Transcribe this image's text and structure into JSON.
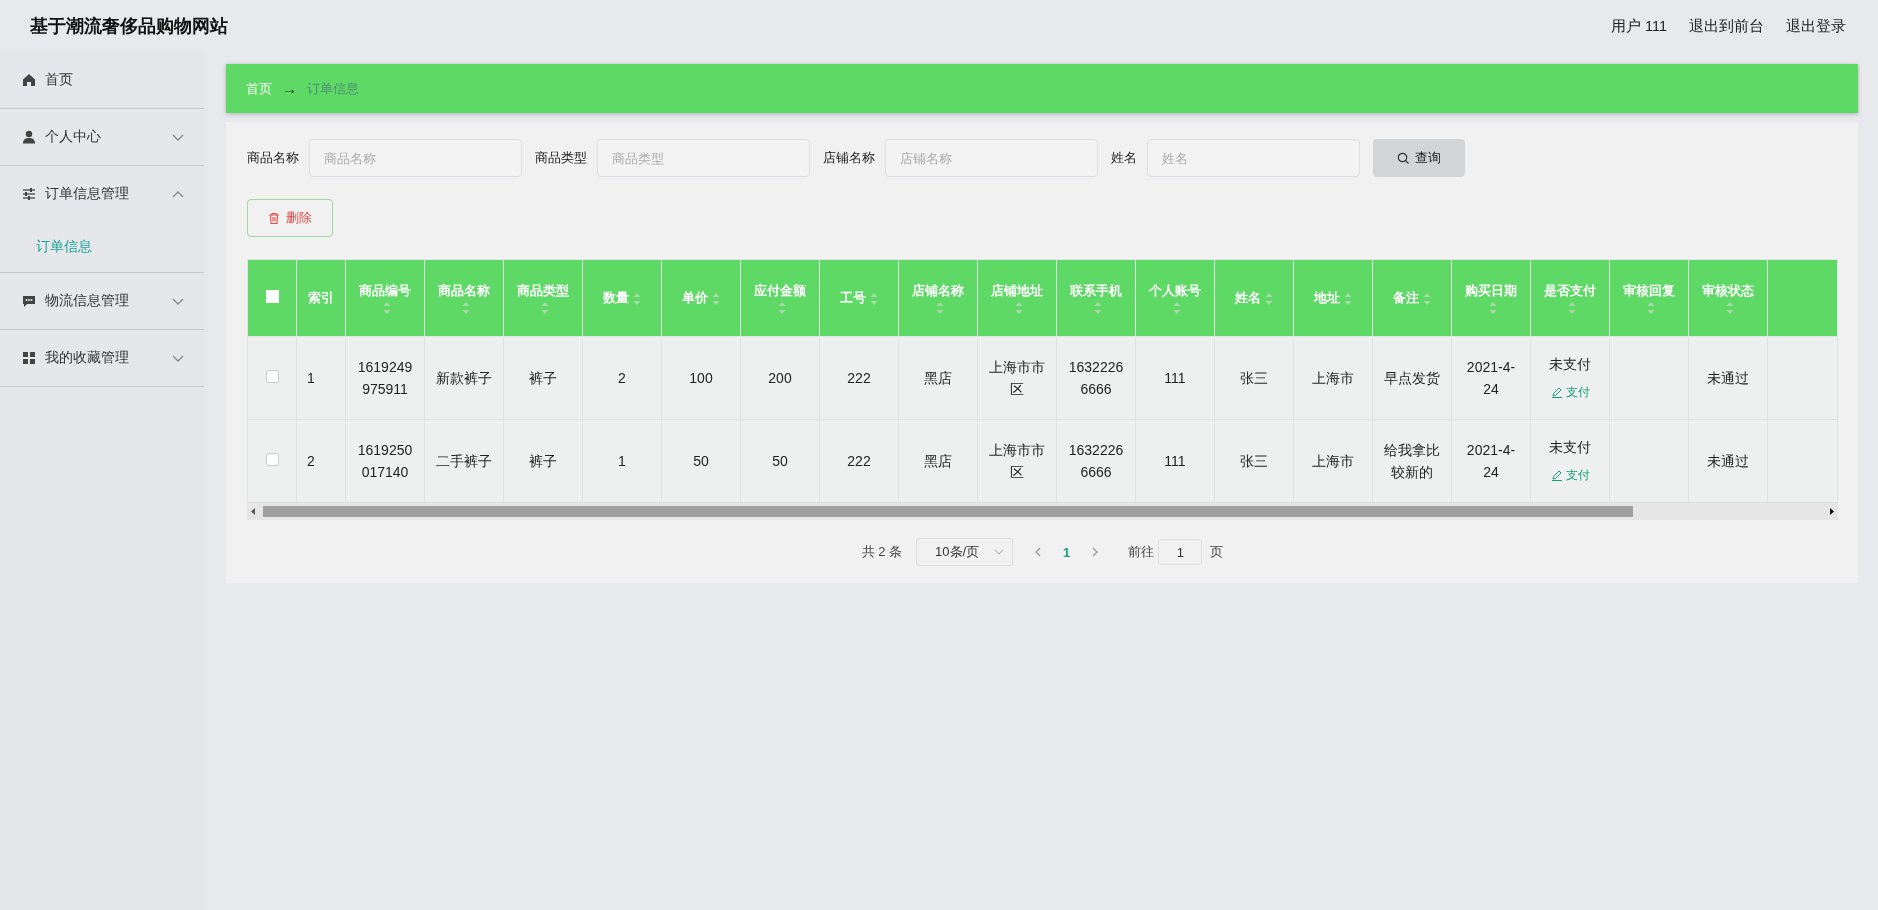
{
  "header": {
    "title": "基于潮流奢侈品购物网站",
    "links": [
      "用户 111",
      "退出到前台",
      "退出登录"
    ]
  },
  "sidebar": {
    "items": [
      {
        "kind": "link",
        "label": "首页"
      },
      {
        "kind": "group",
        "label": "个人中心",
        "expanded": false
      },
      {
        "kind": "group",
        "label": "订单信息管理",
        "expanded": true,
        "children": [
          {
            "label": "订单信息",
            "selected": true
          }
        ]
      },
      {
        "kind": "group",
        "label": "物流信息管理",
        "expanded": false
      },
      {
        "kind": "group",
        "label": "我的收藏管理",
        "expanded": false
      }
    ]
  },
  "breadcrumb": {
    "items": [
      "首页",
      "订单信息"
    ],
    "separator": "→"
  },
  "search": {
    "fields": [
      {
        "label": "商品名称",
        "placeholder": "商品名称"
      },
      {
        "label": "商品类型",
        "placeholder": "商品类型"
      },
      {
        "label": "店铺名称",
        "placeholder": "店铺名称"
      },
      {
        "label": "姓名",
        "placeholder": "姓名"
      }
    ],
    "button": "查询"
  },
  "delete_button": "删除",
  "table": {
    "select_all_checked": false,
    "columns": [
      {
        "label": "索引",
        "sortable": false
      },
      {
        "label": "商品编号",
        "sortable": true
      },
      {
        "label": "商品名称",
        "sortable": true
      },
      {
        "label": "商品类型",
        "sortable": true
      },
      {
        "label": "数量",
        "sortable": true
      },
      {
        "label": "单价",
        "sortable": true
      },
      {
        "label": "应付金额",
        "sortable": true
      },
      {
        "label": "工号",
        "sortable": true
      },
      {
        "label": "店铺名称",
        "sortable": true
      },
      {
        "label": "店铺地址",
        "sortable": true
      },
      {
        "label": "联系手机",
        "sortable": true
      },
      {
        "label": "个人账号",
        "sortable": true
      },
      {
        "label": "姓名",
        "sortable": true
      },
      {
        "label": "地址",
        "sortable": true
      },
      {
        "label": "备注",
        "sortable": true
      },
      {
        "label": "购买日期",
        "sortable": true
      },
      {
        "label": "是否支付",
        "sortable": true
      },
      {
        "label": "审核回复",
        "sortable": true
      },
      {
        "label": "审核状态",
        "sortable": true
      }
    ],
    "rows": [
      {
        "checked": false,
        "cells": [
          "1",
          "1619249975911",
          "新款裤子",
          "裤子",
          "2",
          "100",
          "200",
          "222",
          "黑店",
          "上海市市区",
          "16322266666",
          "111",
          "张三",
          "上海市",
          "早点发货",
          "2021-4-24",
          {
            "text": "未支付",
            "action": "支付"
          },
          null,
          "未通过"
        ]
      },
      {
        "checked": false,
        "cells": [
          "2",
          "1619250017140",
          "二手裤子",
          "裤子",
          "1",
          "50",
          "50",
          "222",
          "黑店",
          "上海市市区",
          "16322266666",
          "111",
          "张三",
          "上海市",
          "给我拿比较新的",
          "2021-4-24",
          {
            "text": "未支付",
            "action": "支付"
          },
          null,
          "未通过"
        ]
      }
    ]
  },
  "pagination": {
    "total": "共 2 条",
    "page_size": "10条/页",
    "pages": [
      {
        "label": "1",
        "selected": true
      }
    ],
    "goto_label": "前往",
    "goto_value": "1",
    "goto_suffix": "页"
  }
}
